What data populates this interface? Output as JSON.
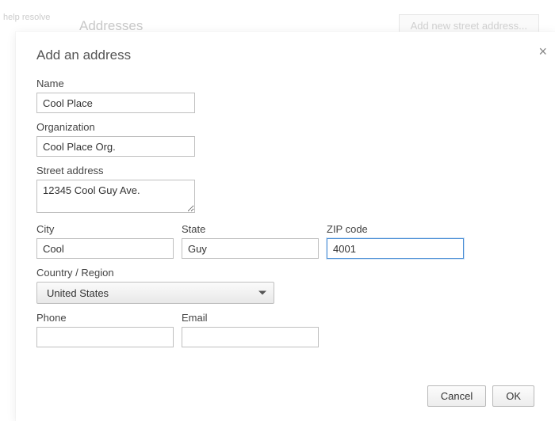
{
  "background": {
    "panel_title": "Addresses",
    "add_button": "Add new street address...",
    "left_hints": [
      "help resolve",
      "",
      ""
    ]
  },
  "modal": {
    "title": "Add an address",
    "name_label": "Name",
    "name_value": "Cool Place",
    "org_label": "Organization",
    "org_value": "Cool Place Org.",
    "street_label": "Street address",
    "street_value": "12345 Cool Guy Ave.",
    "city_label": "City",
    "city_value": "Cool",
    "state_label": "State",
    "state_value": "Guy",
    "zip_label": "ZIP code",
    "zip_value": "4001",
    "country_label": "Country / Region",
    "country_value": "United States",
    "phone_label": "Phone",
    "phone_value": "",
    "email_label": "Email",
    "email_value": "",
    "cancel": "Cancel",
    "ok": "OK"
  }
}
